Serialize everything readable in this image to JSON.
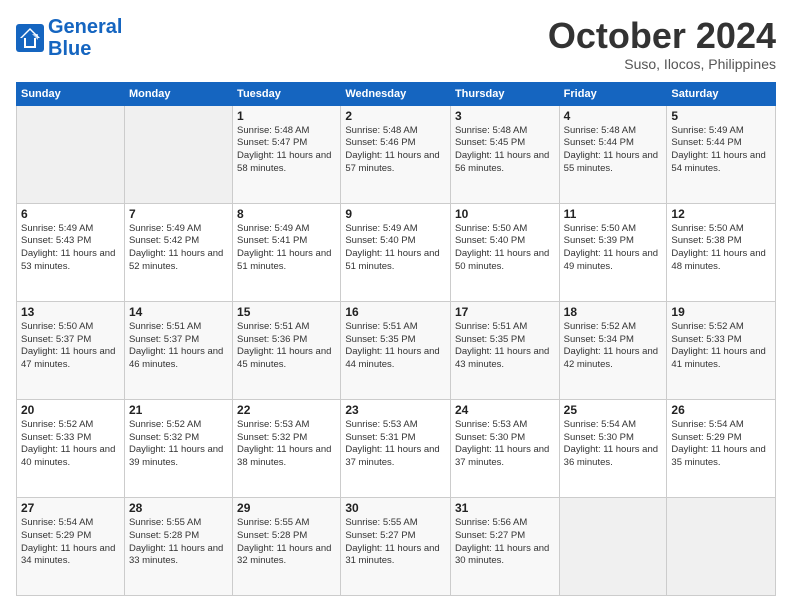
{
  "header": {
    "logo_line1": "General",
    "logo_line2": "Blue",
    "month": "October 2024",
    "location": "Suso, Ilocos, Philippines"
  },
  "weekdays": [
    "Sunday",
    "Monday",
    "Tuesday",
    "Wednesday",
    "Thursday",
    "Friday",
    "Saturday"
  ],
  "weeks": [
    [
      {
        "day": "",
        "info": ""
      },
      {
        "day": "",
        "info": ""
      },
      {
        "day": "1",
        "info": "Sunrise: 5:48 AM\nSunset: 5:47 PM\nDaylight: 11 hours and 58 minutes."
      },
      {
        "day": "2",
        "info": "Sunrise: 5:48 AM\nSunset: 5:46 PM\nDaylight: 11 hours and 57 minutes."
      },
      {
        "day": "3",
        "info": "Sunrise: 5:48 AM\nSunset: 5:45 PM\nDaylight: 11 hours and 56 minutes."
      },
      {
        "day": "4",
        "info": "Sunrise: 5:48 AM\nSunset: 5:44 PM\nDaylight: 11 hours and 55 minutes."
      },
      {
        "day": "5",
        "info": "Sunrise: 5:49 AM\nSunset: 5:44 PM\nDaylight: 11 hours and 54 minutes."
      }
    ],
    [
      {
        "day": "6",
        "info": "Sunrise: 5:49 AM\nSunset: 5:43 PM\nDaylight: 11 hours and 53 minutes."
      },
      {
        "day": "7",
        "info": "Sunrise: 5:49 AM\nSunset: 5:42 PM\nDaylight: 11 hours and 52 minutes."
      },
      {
        "day": "8",
        "info": "Sunrise: 5:49 AM\nSunset: 5:41 PM\nDaylight: 11 hours and 51 minutes."
      },
      {
        "day": "9",
        "info": "Sunrise: 5:49 AM\nSunset: 5:40 PM\nDaylight: 11 hours and 51 minutes."
      },
      {
        "day": "10",
        "info": "Sunrise: 5:50 AM\nSunset: 5:40 PM\nDaylight: 11 hours and 50 minutes."
      },
      {
        "day": "11",
        "info": "Sunrise: 5:50 AM\nSunset: 5:39 PM\nDaylight: 11 hours and 49 minutes."
      },
      {
        "day": "12",
        "info": "Sunrise: 5:50 AM\nSunset: 5:38 PM\nDaylight: 11 hours and 48 minutes."
      }
    ],
    [
      {
        "day": "13",
        "info": "Sunrise: 5:50 AM\nSunset: 5:37 PM\nDaylight: 11 hours and 47 minutes."
      },
      {
        "day": "14",
        "info": "Sunrise: 5:51 AM\nSunset: 5:37 PM\nDaylight: 11 hours and 46 minutes."
      },
      {
        "day": "15",
        "info": "Sunrise: 5:51 AM\nSunset: 5:36 PM\nDaylight: 11 hours and 45 minutes."
      },
      {
        "day": "16",
        "info": "Sunrise: 5:51 AM\nSunset: 5:35 PM\nDaylight: 11 hours and 44 minutes."
      },
      {
        "day": "17",
        "info": "Sunrise: 5:51 AM\nSunset: 5:35 PM\nDaylight: 11 hours and 43 minutes."
      },
      {
        "day": "18",
        "info": "Sunrise: 5:52 AM\nSunset: 5:34 PM\nDaylight: 11 hours and 42 minutes."
      },
      {
        "day": "19",
        "info": "Sunrise: 5:52 AM\nSunset: 5:33 PM\nDaylight: 11 hours and 41 minutes."
      }
    ],
    [
      {
        "day": "20",
        "info": "Sunrise: 5:52 AM\nSunset: 5:33 PM\nDaylight: 11 hours and 40 minutes."
      },
      {
        "day": "21",
        "info": "Sunrise: 5:52 AM\nSunset: 5:32 PM\nDaylight: 11 hours and 39 minutes."
      },
      {
        "day": "22",
        "info": "Sunrise: 5:53 AM\nSunset: 5:32 PM\nDaylight: 11 hours and 38 minutes."
      },
      {
        "day": "23",
        "info": "Sunrise: 5:53 AM\nSunset: 5:31 PM\nDaylight: 11 hours and 37 minutes."
      },
      {
        "day": "24",
        "info": "Sunrise: 5:53 AM\nSunset: 5:30 PM\nDaylight: 11 hours and 37 minutes."
      },
      {
        "day": "25",
        "info": "Sunrise: 5:54 AM\nSunset: 5:30 PM\nDaylight: 11 hours and 36 minutes."
      },
      {
        "day": "26",
        "info": "Sunrise: 5:54 AM\nSunset: 5:29 PM\nDaylight: 11 hours and 35 minutes."
      }
    ],
    [
      {
        "day": "27",
        "info": "Sunrise: 5:54 AM\nSunset: 5:29 PM\nDaylight: 11 hours and 34 minutes."
      },
      {
        "day": "28",
        "info": "Sunrise: 5:55 AM\nSunset: 5:28 PM\nDaylight: 11 hours and 33 minutes."
      },
      {
        "day": "29",
        "info": "Sunrise: 5:55 AM\nSunset: 5:28 PM\nDaylight: 11 hours and 32 minutes."
      },
      {
        "day": "30",
        "info": "Sunrise: 5:55 AM\nSunset: 5:27 PM\nDaylight: 11 hours and 31 minutes."
      },
      {
        "day": "31",
        "info": "Sunrise: 5:56 AM\nSunset: 5:27 PM\nDaylight: 11 hours and 30 minutes."
      },
      {
        "day": "",
        "info": ""
      },
      {
        "day": "",
        "info": ""
      }
    ]
  ]
}
